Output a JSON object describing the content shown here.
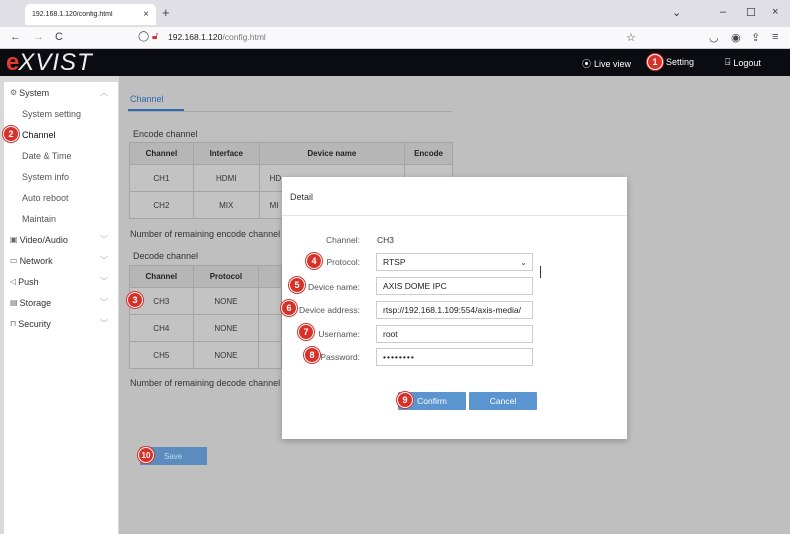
{
  "browser": {
    "tab_title": "192.168.1.120/config.html",
    "tab_close": "×",
    "new_tab": "+",
    "url_host": "192.168.1.120",
    "url_path": "/config.html",
    "back": "←",
    "forward": "→",
    "reload": "C",
    "win_min": "–",
    "win_max": "☐",
    "win_close": "×",
    "tabs_dropdown": "⌄"
  },
  "header": {
    "logo_e": "e",
    "logo_rest": "XVIST",
    "live_view": "Live view",
    "setting": "Setting",
    "logout": "Logout"
  },
  "sidebar": {
    "system": "System",
    "system_setting": "System setting",
    "channel": "Channel",
    "date_time": "Date & Time",
    "system_info": "System info",
    "auto_reboot": "Auto reboot",
    "maintain": "Maintain",
    "video_audio": "Video/Audio",
    "network": "Network",
    "push": "Push",
    "storage": "Storage",
    "security": "Security"
  },
  "main": {
    "tab": "Channel",
    "encode_title": "Encode channel",
    "encode_headers": [
      "Channel",
      "Interface",
      "Device name",
      "Encode"
    ],
    "encode_rows": [
      {
        "channel": "CH1",
        "interface": "HDMI",
        "device": "HD"
      },
      {
        "channel": "CH2",
        "interface": "MIX",
        "device": "MI"
      }
    ],
    "remaining_encode": "Number of remaining encode channel",
    "decode_title": "Decode channel",
    "decode_headers": [
      "Channel",
      "Protocol"
    ],
    "decode_rows": [
      {
        "channel": "CH3",
        "protocol": "NONE"
      },
      {
        "channel": "CH4",
        "protocol": "NONE"
      },
      {
        "channel": "CH5",
        "protocol": "NONE"
      }
    ],
    "remaining_decode": "Number of remaining decode channel",
    "save": "Save"
  },
  "dialog": {
    "title": "Detail",
    "channel_label": "Channel:",
    "channel_value": "CH3",
    "protocol_label": "Protocol:",
    "protocol_value": "RTSP",
    "device_name_label": "Device name:",
    "device_name_value": "AXIS DOME IPC",
    "device_address_label": "Device address:",
    "device_address_value": "rtsp://192.168.1.109:554/axis-media/",
    "username_label": "Username:",
    "username_value": "root",
    "password_label": "Password:",
    "password_value": "••••••••",
    "confirm": "Confirm",
    "cancel": "Cancel"
  },
  "markers": [
    "1",
    "2",
    "3",
    "4",
    "5",
    "6",
    "7",
    "8",
    "9",
    "10"
  ],
  "colors": {
    "accent": "#5b95d0",
    "marker": "#d6322a",
    "header_bg": "#0b0b12",
    "logo_e": "#e63b2e"
  }
}
